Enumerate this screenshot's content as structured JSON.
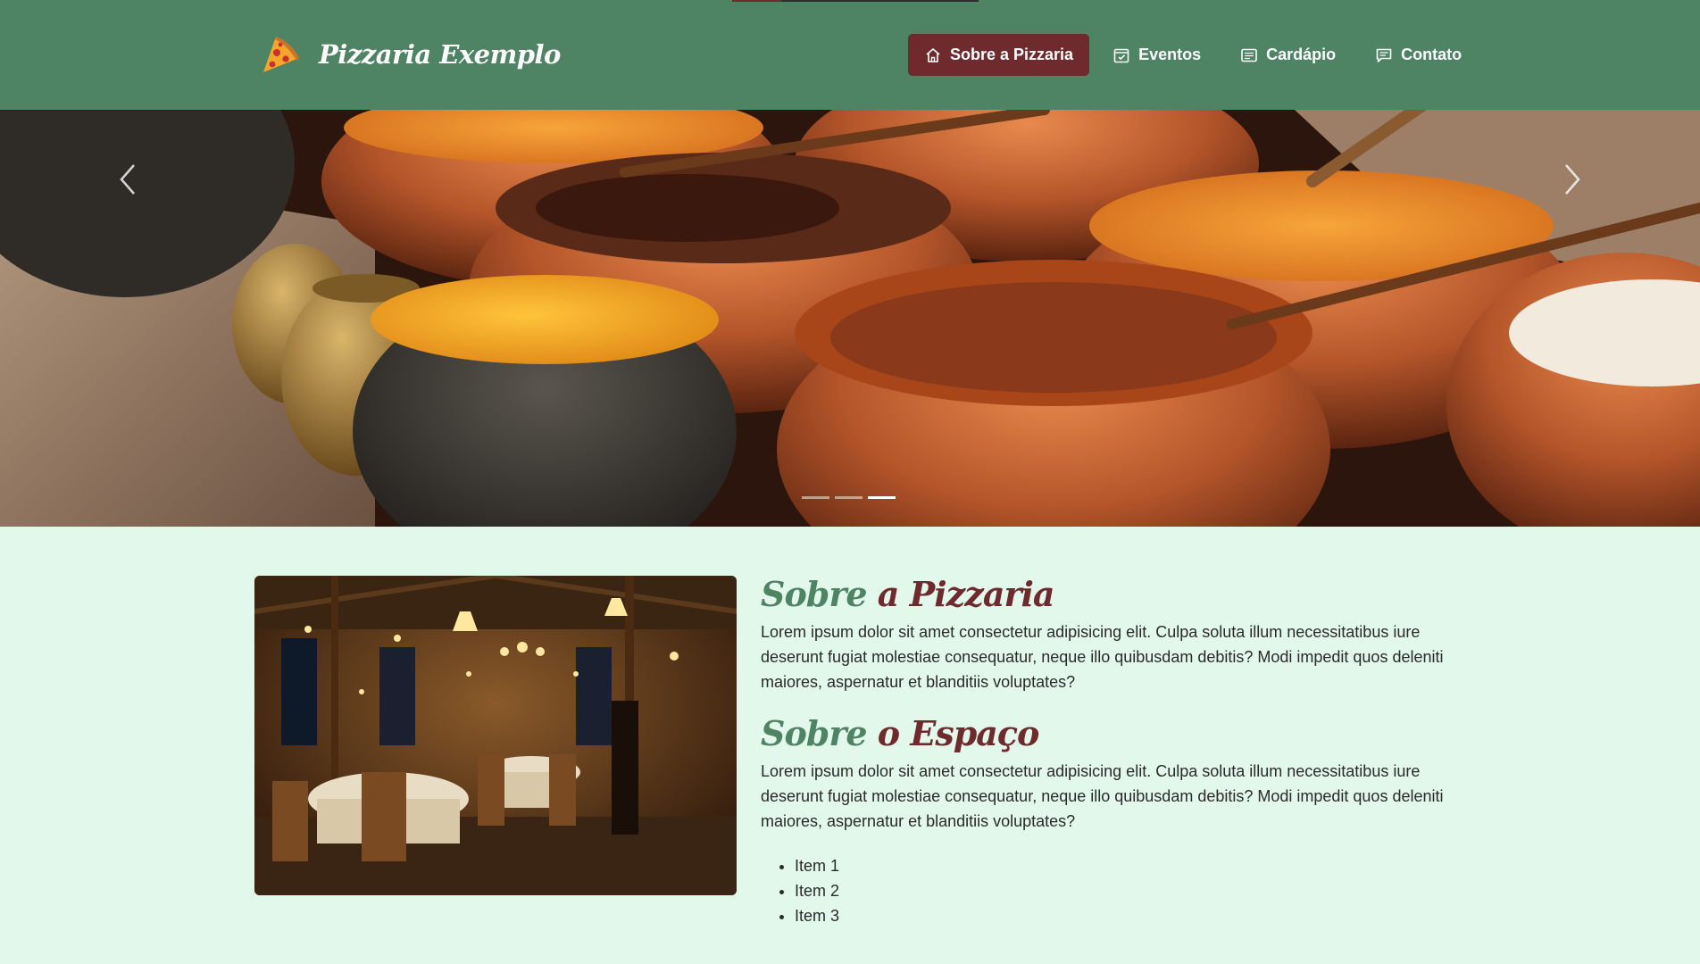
{
  "brand": {
    "name": "Pizzaria Exemplo",
    "logo_icon": "pizza-slice-icon"
  },
  "nav": {
    "items": [
      {
        "label": "Sobre a Pizzaria",
        "icon": "home-icon",
        "active": true
      },
      {
        "label": "Eventos",
        "icon": "calendar-check-icon",
        "active": false
      },
      {
        "label": "Cardápio",
        "icon": "menu-list-icon",
        "active": false
      },
      {
        "label": "Contato",
        "icon": "chat-icon",
        "active": false
      }
    ]
  },
  "carousel": {
    "prev_icon": "chevron-left-icon",
    "next_icon": "chevron-right-icon",
    "slide_count": 3,
    "active_slide": 3
  },
  "about": {
    "title_part1": "Sobre",
    "title_part2": "a Pizzaria",
    "text": "Lorem ipsum dolor sit amet consectetur adipisicing elit. Culpa soluta illum necessitatibus iure deserunt fugiat molestiae consequatur, neque illo quibusdam debitis? Modi impedit quos deleniti maiores, aspernatur et blanditiis voluptates?"
  },
  "space": {
    "title_part1": "Sobre",
    "title_part2": "o Espaço",
    "text": "Lorem ipsum dolor sit amet consectetur adipisicing elit. Culpa soluta illum necessitatibus iure deserunt fugiat molestiae consequatur, neque illo quibusdam debitis? Modi impedit quos deleniti maiores, aspernatur et blanditiis voluptates?",
    "items": [
      "Item 1",
      "Item 2",
      "Item 3"
    ]
  },
  "colors": {
    "navbar": "#4e8463",
    "accent": "#6e2a2c",
    "background": "#e2f8ea"
  }
}
